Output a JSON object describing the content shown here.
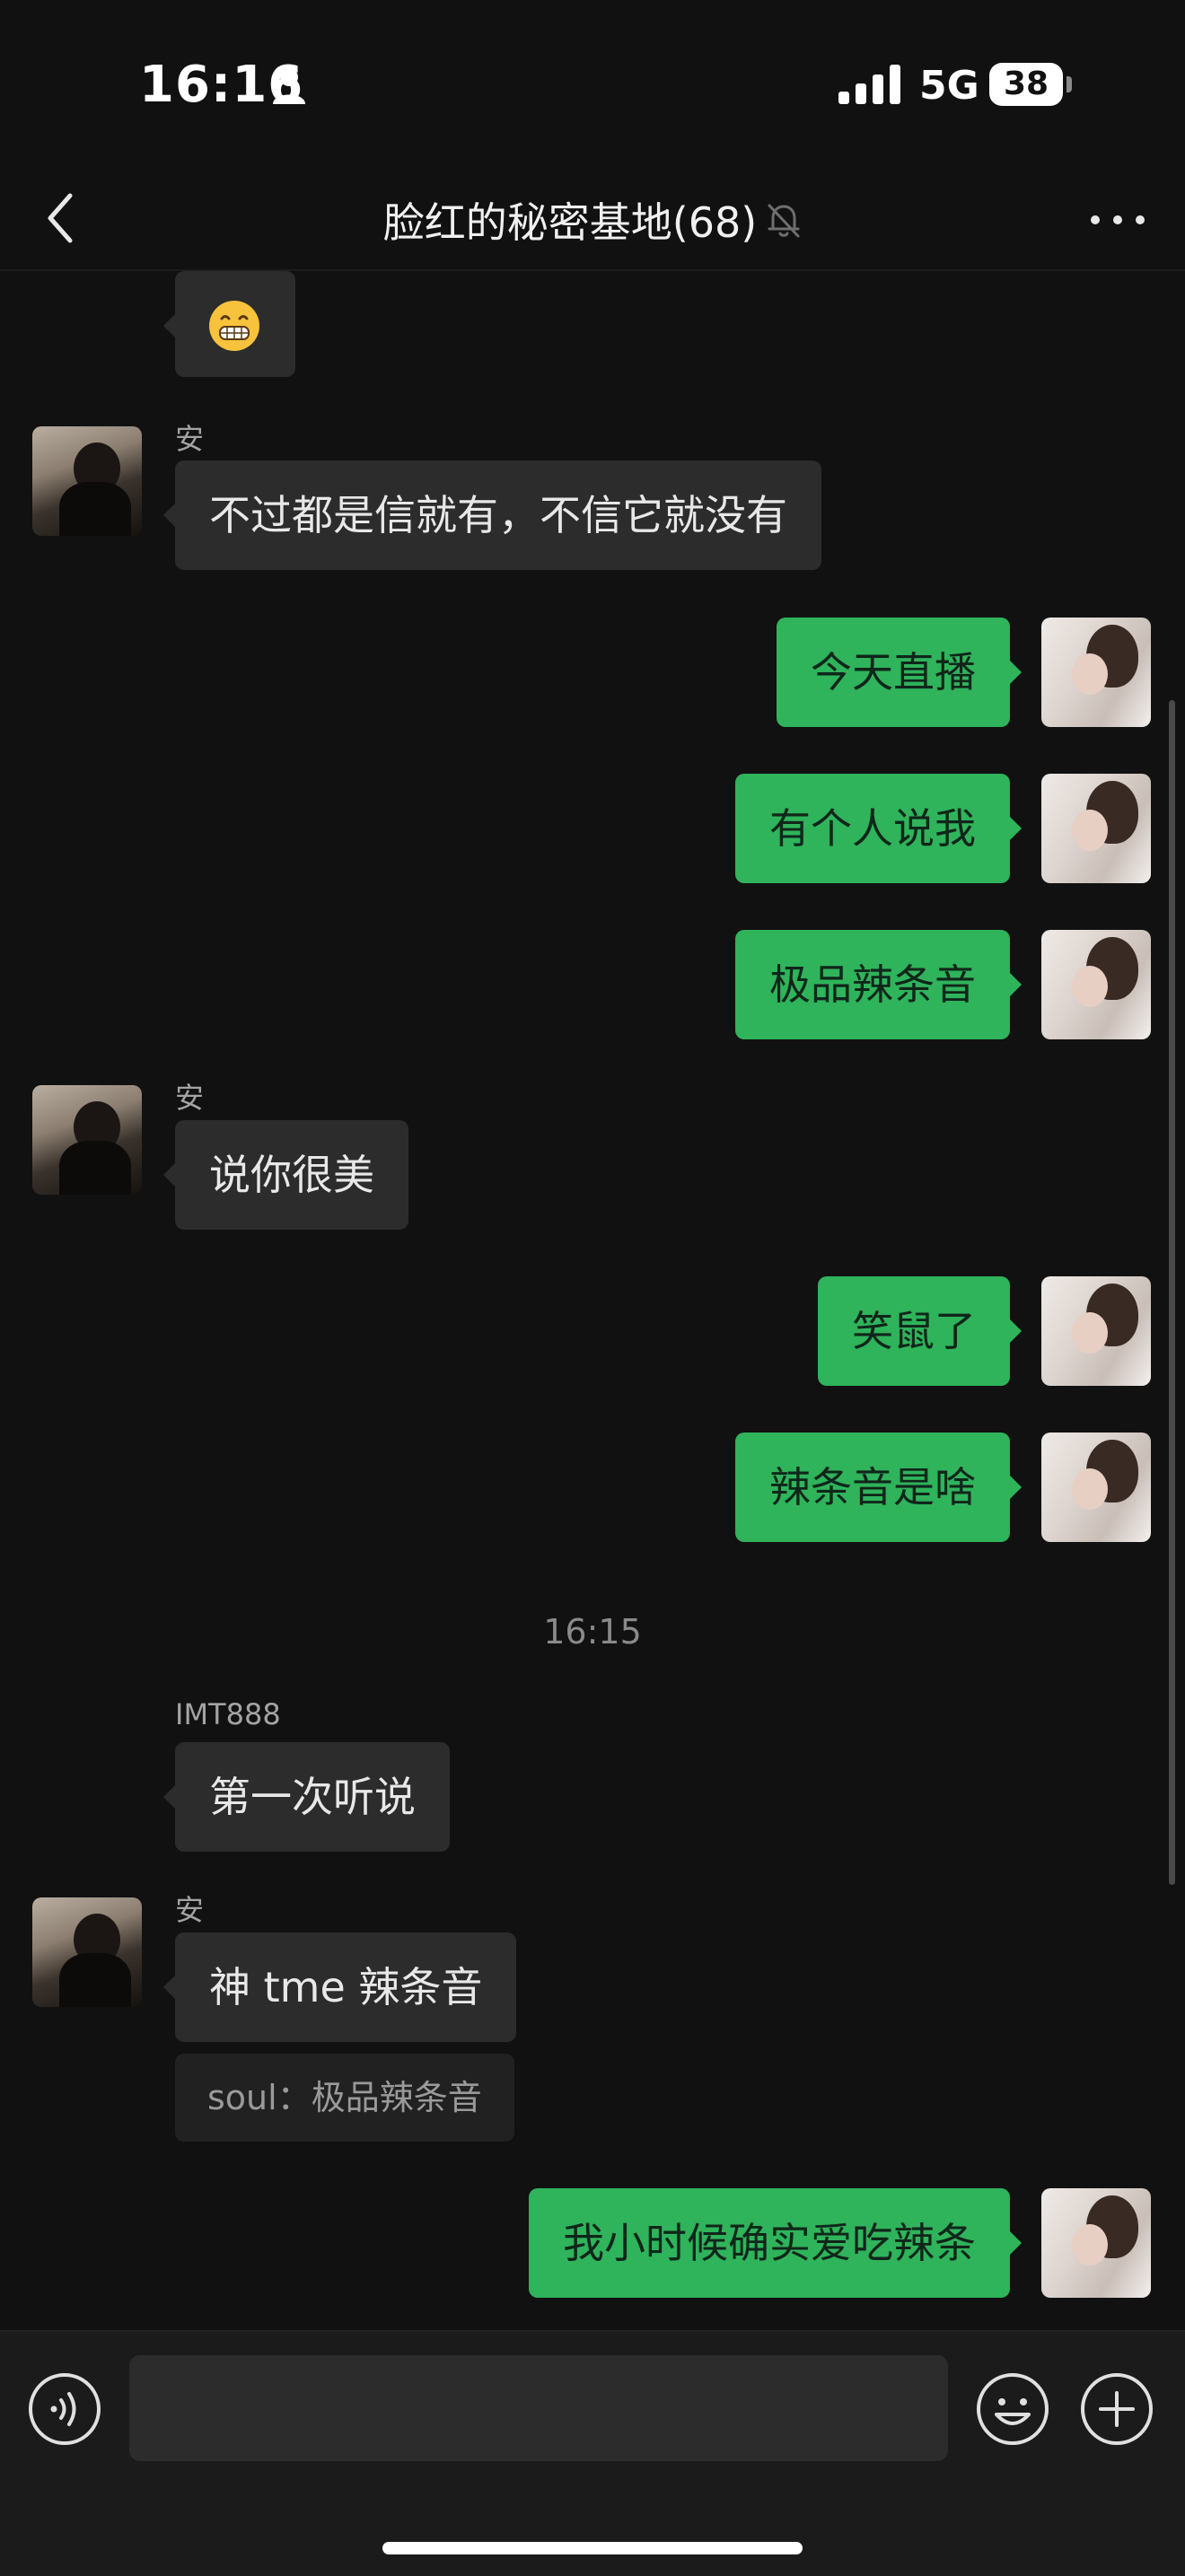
{
  "status_bar": {
    "time": "16:16",
    "network": "5G",
    "battery": "38"
  },
  "nav": {
    "title": "脸红的秘密基地(68)"
  },
  "messages": [
    {
      "side": "in",
      "sender": "",
      "text": "",
      "emoji": "grinning-face"
    },
    {
      "side": "in",
      "sender": "安",
      "text": "不过都是信就有，不信它就没有"
    },
    {
      "side": "out",
      "text": "今天直播"
    },
    {
      "side": "out",
      "text": "有个人说我"
    },
    {
      "side": "out",
      "text": "极品辣条音"
    },
    {
      "side": "in",
      "sender": "安",
      "text": "说你很美"
    },
    {
      "side": "out",
      "text": "笑鼠了"
    },
    {
      "side": "out",
      "text": "辣条音是啥"
    },
    {
      "side": "in",
      "sender": "IMT888",
      "text": "第一次听说"
    },
    {
      "side": "in",
      "sender": "安",
      "text": "神 tme 辣条音",
      "quote": "soul：极品辣条音"
    },
    {
      "side": "out",
      "text": "我小时候确实爱吃辣条"
    }
  ],
  "timestamp": "16:15",
  "input": {
    "value": ""
  },
  "colors": {
    "background": "#111111",
    "incoming_bubble": "#2c2c2c",
    "outgoing_bubble": "#2fb35b",
    "input_bar": "#1b1b1b"
  }
}
